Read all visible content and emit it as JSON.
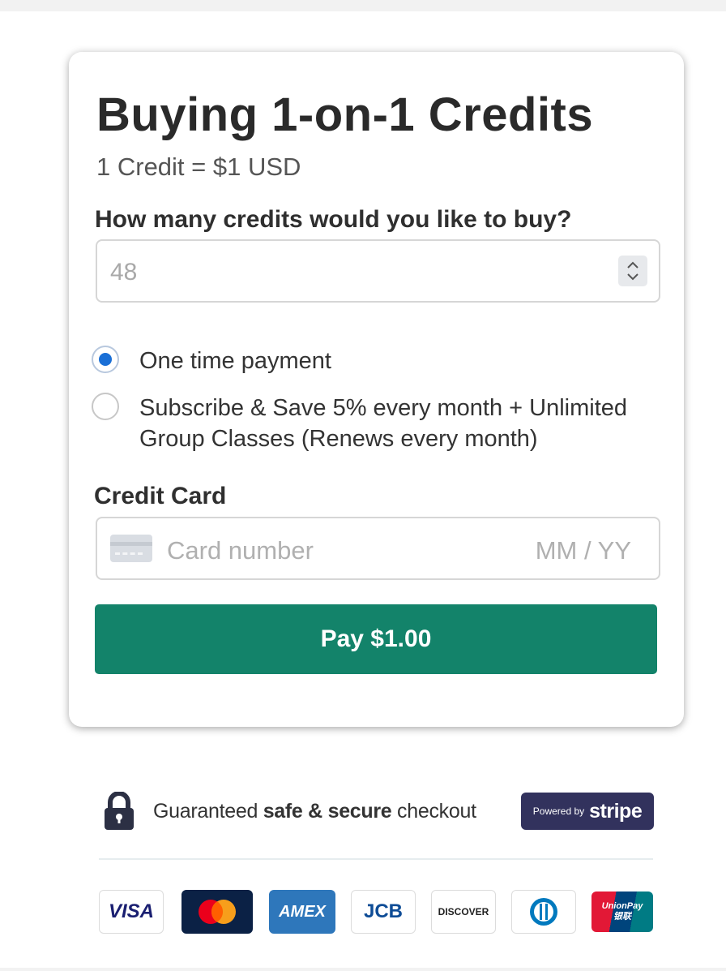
{
  "form": {
    "title": "Buying 1-on-1 Credits",
    "subtitle": "1 Credit = $1 USD",
    "quantity_label": "How many credits would you like to buy?",
    "quantity_value": "48",
    "options": [
      {
        "label": "One time payment",
        "selected": true
      },
      {
        "label_line1": "Subscribe & Save 5% every month + Unlimited",
        "label_line2": "Group Classes (Renews every month)",
        "selected": false
      }
    ],
    "credit_card_label": "Credit Card",
    "card_number_placeholder": "Card number",
    "expiry_placeholder": "MM / YY",
    "pay_button": "Pay $1.00"
  },
  "footer": {
    "secure_prefix": "Guaranteed ",
    "secure_bold": "safe & secure",
    "secure_suffix": " checkout",
    "powered_by": "Powered by",
    "stripe": "stripe",
    "payment_logos": [
      {
        "name": "visa",
        "text": "VISA",
        "color": "#1a1f71"
      },
      {
        "name": "mastercard",
        "text": "",
        "color": "#0b2145"
      },
      {
        "name": "amex",
        "text": "AMEX",
        "color": "#2e77bb"
      },
      {
        "name": "jcb",
        "text": "JCB",
        "color": "#0e4c96"
      },
      {
        "name": "discover",
        "text": "DISCOVER",
        "color": "#222222"
      },
      {
        "name": "diners",
        "text": "",
        "color": "#0079be"
      },
      {
        "name": "unionpay",
        "text": "UnionPay 银联",
        "color": "#e21836"
      }
    ]
  }
}
